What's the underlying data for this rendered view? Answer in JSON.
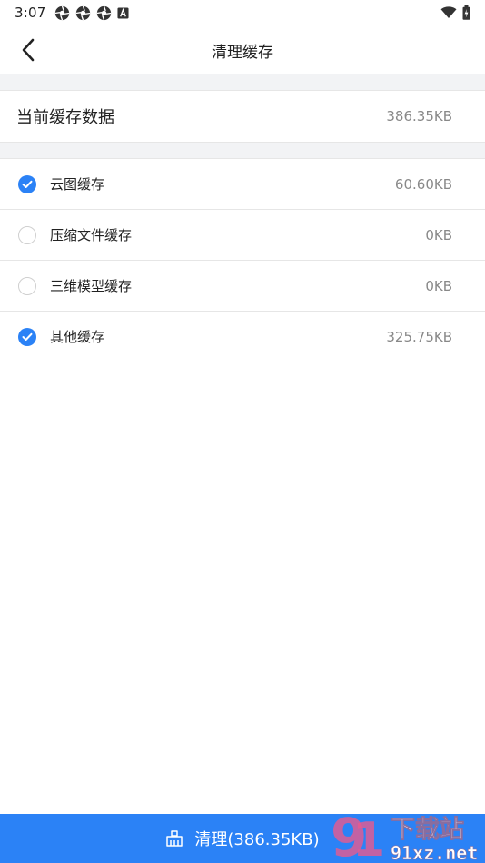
{
  "status_bar": {
    "time": "3:07",
    "notification_icons": [
      "aperture-icon",
      "aperture-icon",
      "aperture-icon",
      "a-box-icon"
    ],
    "right_icons": [
      "wifi-icon",
      "battery-icon"
    ]
  },
  "nav": {
    "title": "清理缓存",
    "back_icon": "chevron-left-icon"
  },
  "summary": {
    "label": "当前缓存数据",
    "value": "386.35KB"
  },
  "items": [
    {
      "label": "云图缓存",
      "value": "60.60KB",
      "checked": true
    },
    {
      "label": "压缩文件缓存",
      "value": "0KB",
      "checked": false
    },
    {
      "label": "三维模型缓存",
      "value": "0KB",
      "checked": false
    },
    {
      "label": "其他缓存",
      "value": "325.75KB",
      "checked": true
    }
  ],
  "clean_button": {
    "label": "清理(386.35KB)",
    "icon": "broom-icon"
  },
  "watermark": {
    "text_top": "下载站",
    "text_bottom": "91xz.net"
  },
  "colors": {
    "accent": "#2b82f6",
    "divider_bg": "#f2f3f5",
    "secondary_text": "#888888"
  }
}
